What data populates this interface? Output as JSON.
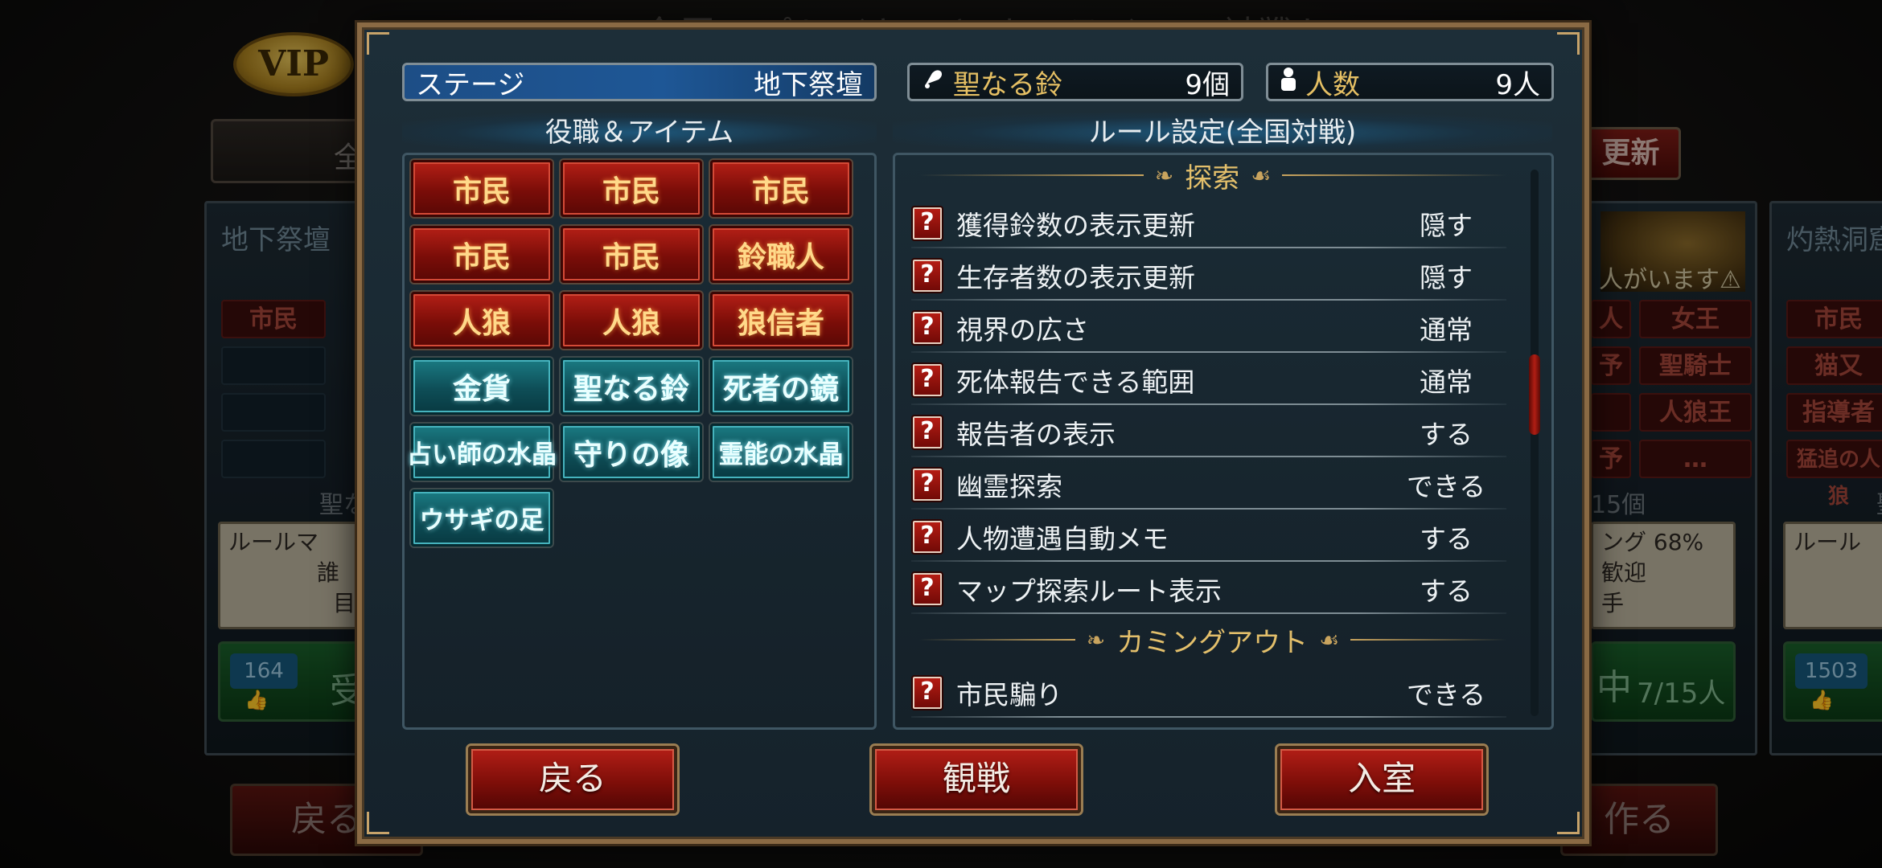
{
  "background": {
    "top_text": "全国のプレイヤーとオンラインで対戦します",
    "vip": "VIP",
    "tab": "全",
    "update_button": "更新",
    "left_panel": {
      "title": "地下祭壇",
      "chip": "市民",
      "note": "聖な",
      "card_lines": [
        "ルールマ",
        "誰",
        "目"
      ],
      "likes": "164",
      "join": "受"
    },
    "right_panel": {
      "warning": "人がいます⚠",
      "chips": [
        "人",
        "女王",
        "予",
        "聖騎士",
        "",
        "人狼王",
        "予",
        "…"
      ],
      "count": "15個",
      "card_lines": [
        "ング 68%",
        "歓迎",
        "手"
      ],
      "status": "中",
      "players": "7/15人"
    },
    "far_panel": {
      "title": "灼熱洞窟",
      "chips": [
        "市民",
        "猫又",
        "指導者",
        "猛追の人狼"
      ],
      "note": "聖",
      "card_line": "ルール",
      "likes": "1503"
    },
    "bottom_back": "戻る",
    "bottom_create": "作る"
  },
  "modal": {
    "stage_label": "ステージ",
    "stage_value": "地下祭壇",
    "bell_label": "聖なる鈴",
    "bell_value": "9個",
    "people_label": "人数",
    "people_value": "9人",
    "roles_title": "役職＆アイテム",
    "rules_title": "ルール設定(全国対戦)",
    "roles": [
      {
        "label": "市民",
        "type": "red"
      },
      {
        "label": "市民",
        "type": "red"
      },
      {
        "label": "市民",
        "type": "red"
      },
      {
        "label": "市民",
        "type": "red"
      },
      {
        "label": "市民",
        "type": "red"
      },
      {
        "label": "鈴職人",
        "type": "red"
      },
      {
        "label": "人狼",
        "type": "red"
      },
      {
        "label": "人狼",
        "type": "red"
      },
      {
        "label": "狼信者",
        "type": "red"
      },
      {
        "label": "金貨",
        "type": "teal"
      },
      {
        "label": "聖なる鈴",
        "type": "teal"
      },
      {
        "label": "死者の鏡",
        "type": "teal"
      },
      {
        "label": "占い師の水晶",
        "type": "teal"
      },
      {
        "label": "守りの像",
        "type": "teal"
      },
      {
        "label": "霊能の水晶",
        "type": "teal"
      },
      {
        "label": "ウサギの足",
        "type": "teal"
      }
    ],
    "categories": [
      "探索",
      "カミングアウト"
    ],
    "help_glyph": "?",
    "rules": [
      {
        "label": "獲得鈴数の表示更新",
        "value": "隠す"
      },
      {
        "label": "生存者数の表示更新",
        "value": "隠す"
      },
      {
        "label": "視界の広さ",
        "value": "通常"
      },
      {
        "label": "死体報告できる範囲",
        "value": "通常"
      },
      {
        "label": "報告者の表示",
        "value": "する"
      },
      {
        "label": "幽霊探索",
        "value": "できる"
      },
      {
        "label": "人物遭遇自動メモ",
        "value": "する"
      },
      {
        "label": "マップ探索ルート表示",
        "value": "する"
      },
      {
        "label": "市民騙り",
        "value": "できる"
      }
    ],
    "buttons": {
      "back": "戻る",
      "watch": "観戦",
      "enter": "入室"
    }
  }
}
